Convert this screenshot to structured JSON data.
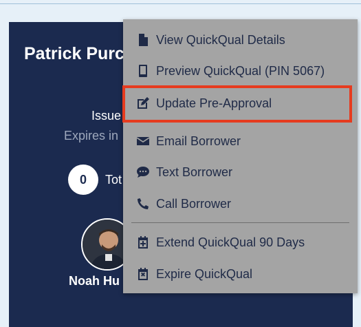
{
  "card": {
    "title": "Patrick Purc",
    "issued": "Issue",
    "expires": "Expires in",
    "total_count": "0",
    "total_label": "Tot",
    "agent_name": "Noah Hu"
  },
  "menu": {
    "items": [
      {
        "label": "View QuickQual Details",
        "icon": "file-icon"
      },
      {
        "label": "Preview QuickQual (PIN 5067)",
        "icon": "mobile-phone-icon"
      },
      {
        "label": "Update Pre-Approval",
        "icon": "edit-icon"
      },
      {
        "label": "Email Borrower",
        "icon": "envelope-icon"
      },
      {
        "label": "Text Borrower",
        "icon": "chat-bubble-icon"
      },
      {
        "label": "Call Borrower",
        "icon": "phone-icon"
      },
      {
        "label": "Extend QuickQual 90 Days",
        "icon": "calendar-plus-icon"
      },
      {
        "label": "Expire QuickQual",
        "icon": "calendar-x-icon"
      }
    ]
  },
  "colors": {
    "page_background": "#e6f0f8",
    "card_background": "#1b2a4f",
    "menu_background": "#a4a4a4",
    "menu_text": "#1f2a47",
    "highlight_border": "#e63b1f"
  }
}
